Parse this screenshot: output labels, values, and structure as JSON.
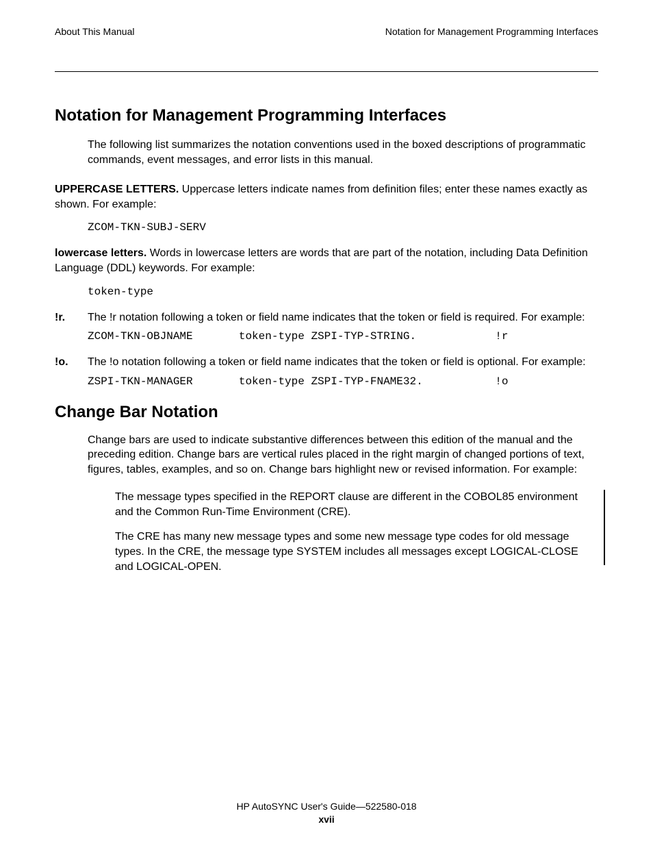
{
  "header": {
    "left": "About This Manual",
    "right": "Notation for Management Programming Interfaces"
  },
  "section1": {
    "heading": "Notation for Management Programming Interfaces",
    "intro": "The following list summarizes the notation conventions used in the boxed descriptions of programmatic commands, event messages, and error lists in this manual.",
    "items": {
      "uppercase": {
        "label": "UPPERCASE LETTERS.",
        "text": "  Uppercase letters indicate names from definition files; enter these names exactly as shown.  For example:",
        "code": "ZCOM-TKN-SUBJ-SERV"
      },
      "lowercase": {
        "label": "lowercase letters.",
        "text": "  Words in lowercase letters are words that are part of the notation, including Data Definition Language (DDL) keywords.  For example:",
        "code": "token-type"
      },
      "r": {
        "label": "!r.",
        "text": "The !r notation following a token or field name indicates that the token or field is required.  For example:",
        "code": "ZCOM-TKN-OBJNAME       token-type ZSPI-TYP-STRING.            !r"
      },
      "o": {
        "label": "!o.",
        "text": "The !o notation following a token or field name indicates that the token or field is optional.  For example:",
        "code": "ZSPI-TKN-MANAGER       token-type ZSPI-TYP-FNAME32.           !o"
      }
    }
  },
  "section2": {
    "heading": "Change Bar Notation",
    "para": "Change bars are used to indicate substantive differences between this edition of the manual and the preceding edition.  Change bars are vertical rules placed in the right margin of changed portions of text, figures, tables, examples, and so on.  Change bars highlight new or revised information.  For example:",
    "example1": "The message types specified in the REPORT clause are different in the COBOL85 environment and the Common Run-Time Environment (CRE).",
    "example2": "The CRE has many new message types and some new message type codes for old message types.  In the CRE, the message type SYSTEM includes all messages except LOGICAL-CLOSE and LOGICAL-OPEN."
  },
  "footer": {
    "line1": "HP AutoSYNC User's Guide—522580-018",
    "pagenum": "xvii"
  }
}
